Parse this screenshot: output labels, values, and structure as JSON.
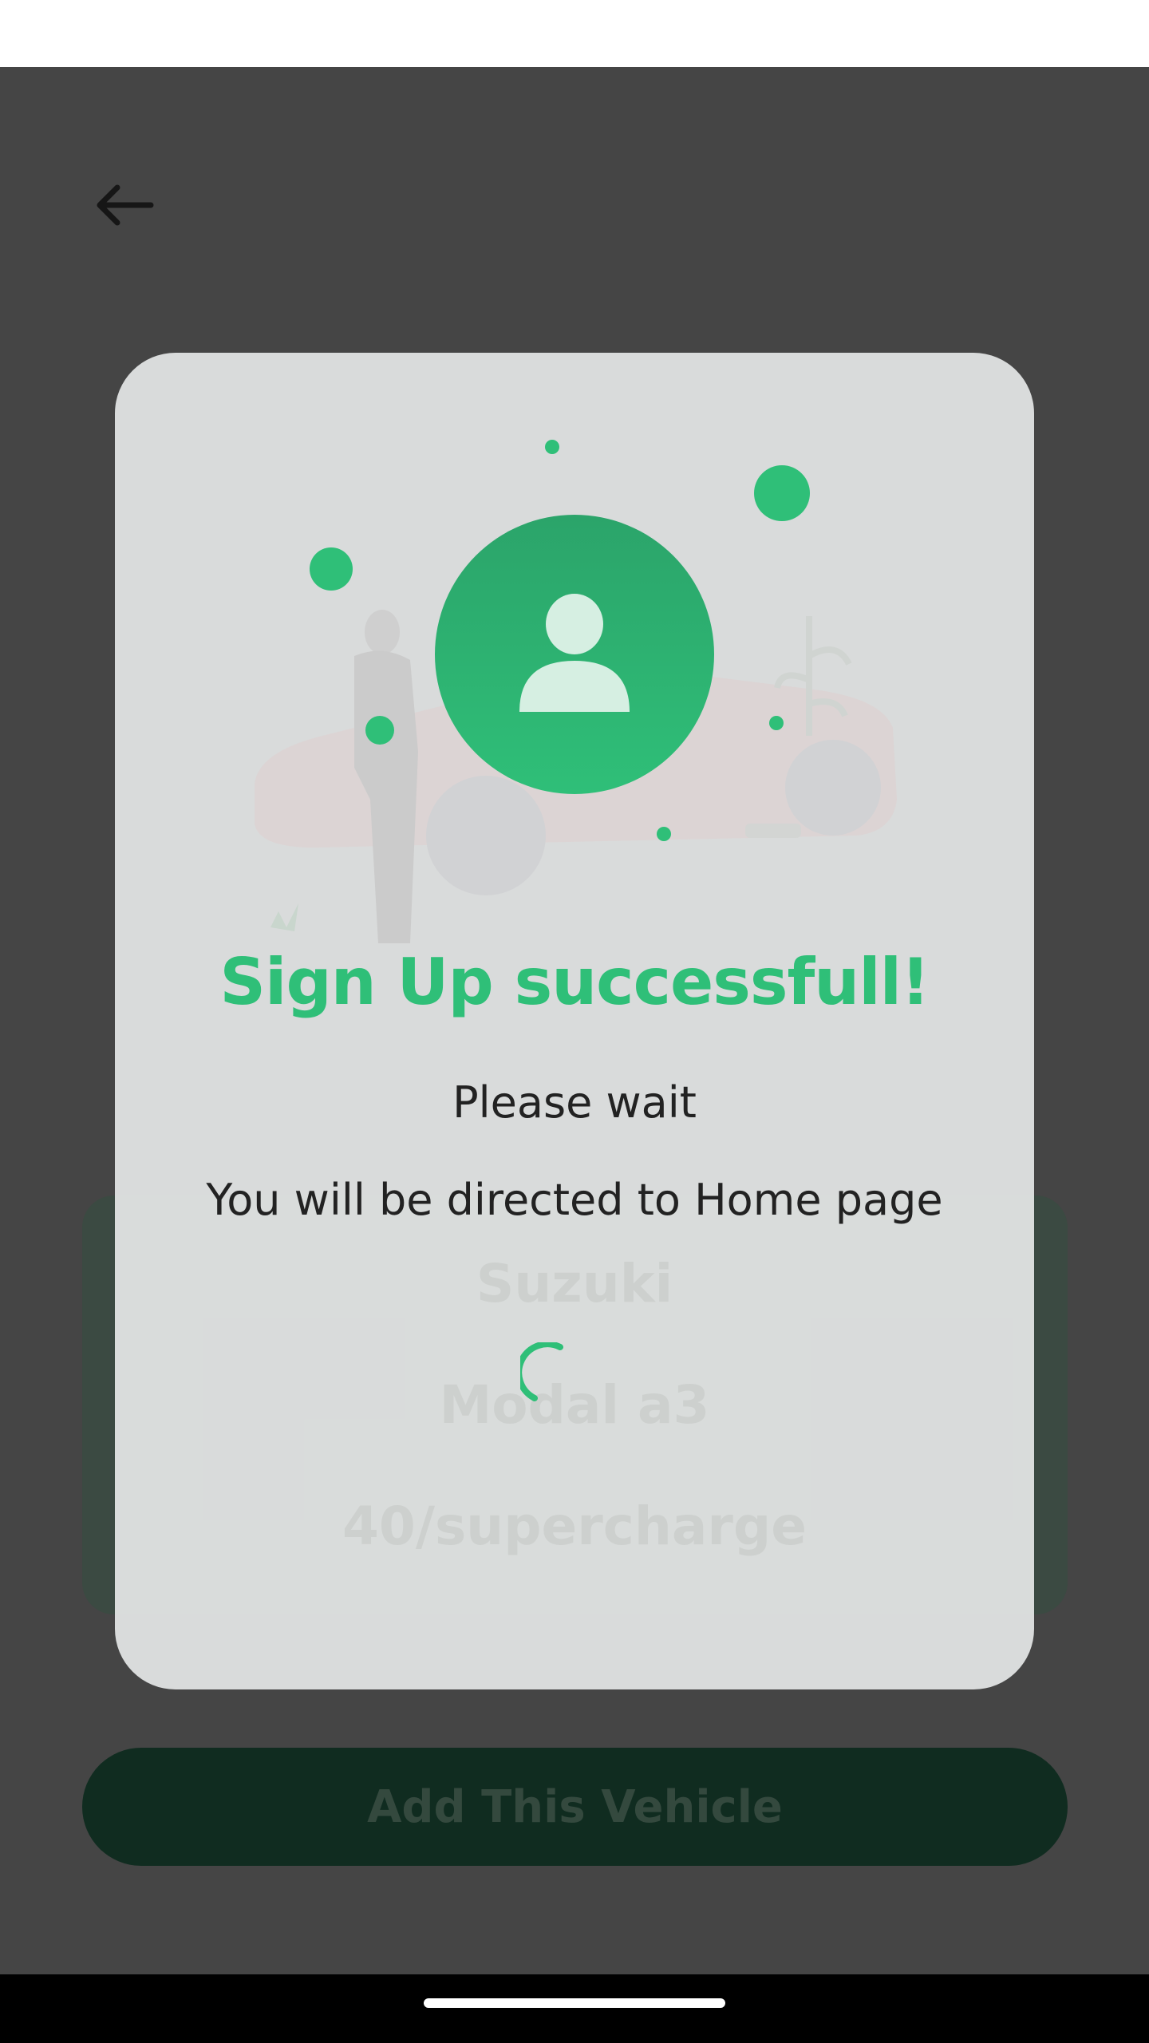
{
  "colors": {
    "accent": "#2fbf78",
    "overlay": "#454545",
    "modal_bg": "#dddfdf",
    "text_dark": "#222222"
  },
  "header": {
    "back_icon": "arrow-left-icon"
  },
  "vehicle": {
    "make": "Suzuki",
    "model": "Modal a3",
    "charger": "40/supercharge"
  },
  "actions": {
    "add_vehicle_label": "Add This Vehicle"
  },
  "modal": {
    "icon": "user-icon",
    "title": "Sign Up successfull!",
    "line1": "Please wait",
    "line2": "You will be directed to Home page",
    "loading_icon": "spinner-icon"
  }
}
